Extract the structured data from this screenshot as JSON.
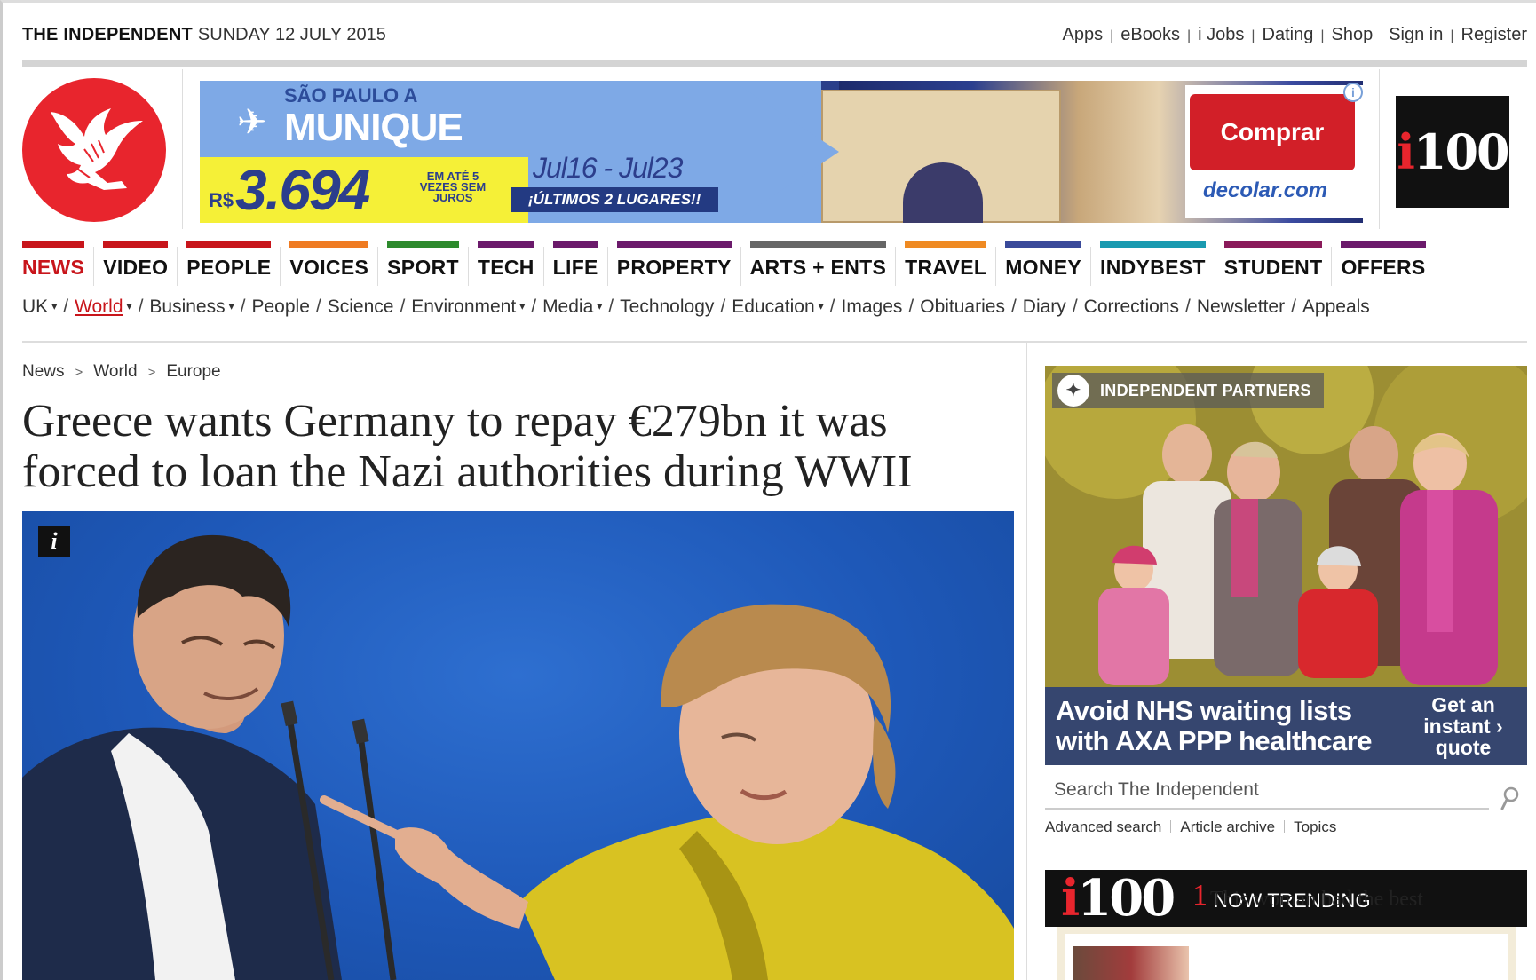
{
  "masthead": {
    "brand": "THE INDEPENDENT",
    "date": "SUNDAY 12 JULY 2015",
    "links": [
      "Apps",
      "eBooks",
      "i Jobs",
      "Dating",
      "Shop"
    ],
    "sign_in": "Sign in",
    "register": "Register"
  },
  "ad": {
    "from": "SÃO PAULO A",
    "destination": "MUNIQUE",
    "currency": "R$",
    "price": "3.694",
    "terms": "EM ATÉ 5 VEZES SEM JUROS",
    "dates": "Jul16 - Jul23",
    "urgency": "¡ÚLTIMOS 2 LUGARES!!",
    "cta": "Comprar",
    "advertiser": "decolar.com"
  },
  "i100_label": "i100",
  "sections": [
    {
      "label": "NEWS",
      "color": "#c8151b",
      "active": true
    },
    {
      "label": "VIDEO",
      "color": "#c8151b"
    },
    {
      "label": "PEOPLE",
      "color": "#c8151b"
    },
    {
      "label": "VOICES",
      "color": "#ef7b22"
    },
    {
      "label": "SPORT",
      "color": "#2d8a2d"
    },
    {
      "label": "TECH",
      "color": "#6b1a6b"
    },
    {
      "label": "LIFE",
      "color": "#6b1a6b"
    },
    {
      "label": "PROPERTY",
      "color": "#6b1a6b"
    },
    {
      "label": "ARTS + ENTS",
      "color": "#666666"
    },
    {
      "label": "TRAVEL",
      "color": "#ef8a22"
    },
    {
      "label": "MONEY",
      "color": "#3a4a9a"
    },
    {
      "label": "INDYBEST",
      "color": "#1a9ab0"
    },
    {
      "label": "STUDENT",
      "color": "#8a1a5a"
    },
    {
      "label": "OFFERS",
      "color": "#6b1a6b"
    }
  ],
  "subnav": [
    {
      "label": "UK",
      "caret": true
    },
    {
      "label": "World",
      "caret": true,
      "active": true
    },
    {
      "label": "Business",
      "caret": true
    },
    {
      "label": "People"
    },
    {
      "label": "Science"
    },
    {
      "label": "Environment",
      "caret": true
    },
    {
      "label": "Media",
      "caret": true
    },
    {
      "label": "Technology"
    },
    {
      "label": "Education",
      "caret": true
    },
    {
      "label": "Images"
    },
    {
      "label": "Obituaries"
    },
    {
      "label": "Diary"
    },
    {
      "label": "Corrections"
    },
    {
      "label": "Newsletter"
    },
    {
      "label": "Appeals"
    }
  ],
  "breadcrumb": [
    "News",
    "World",
    "Europe"
  ],
  "article": {
    "headline_line1": "Greece wants Germany to repay €279bn it was",
    "headline_line2": "forced to loan the Nazi authorities during WWII",
    "image_info": "i"
  },
  "sidebar": {
    "partner_tag": "INDEPENDENT PARTNERS",
    "partner_msg_line1": "Avoid NHS waiting lists",
    "partner_msg_line2": "with AXA PPP healthcare",
    "partner_cta": "Get an instant › quote",
    "search_placeholder": "Search The Independent",
    "search_links": [
      "Advanced search",
      "Article archive",
      "Topics"
    ],
    "trending_label": "NOW TRENDING",
    "trending_number": "1",
    "trending_title": "This woman had the best"
  }
}
